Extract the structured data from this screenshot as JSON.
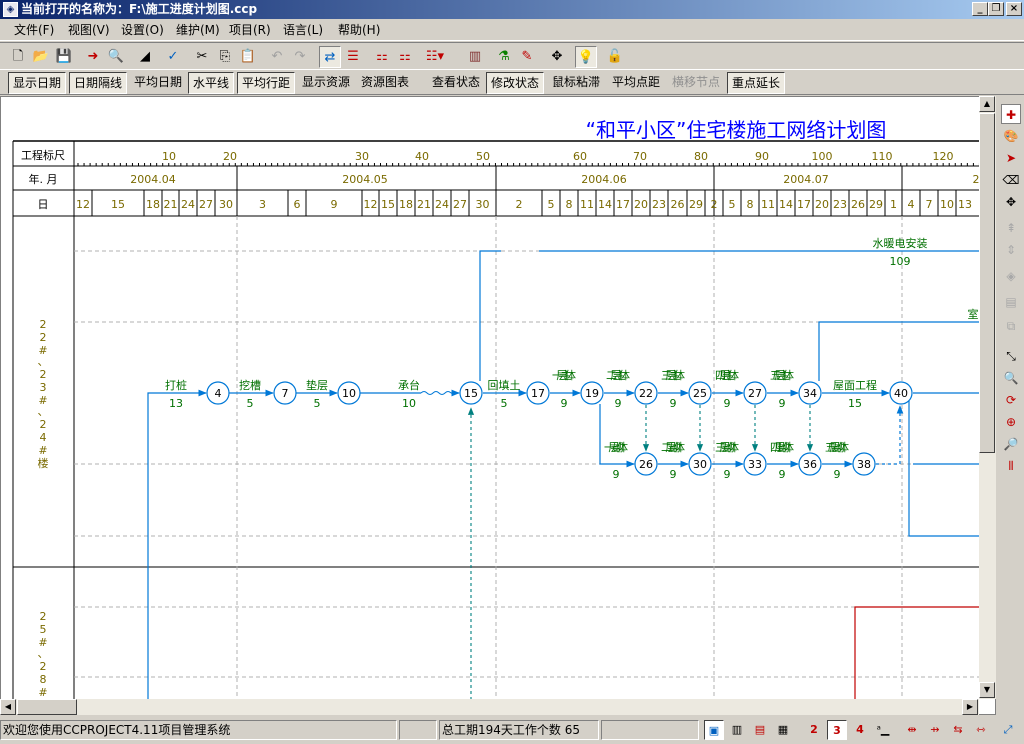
{
  "window": {
    "title": "当前打开的名称为：F:\\施工进度计划图.ccp"
  },
  "menu": [
    "文件(F)",
    "视图(V)",
    "设置(O)",
    "维护(M)",
    "项目(R)",
    "语言(L)",
    "帮助(H)"
  ],
  "toolbar2": [
    {
      "label": "显示日期",
      "state": "pressed"
    },
    {
      "label": "日期隔线",
      "state": "pressed"
    },
    {
      "label": "平均日期",
      "state": "normal"
    },
    {
      "label": "水平线",
      "state": "pressed"
    },
    {
      "label": "平均行距",
      "state": "pressed"
    },
    {
      "label": "显示资源",
      "state": "normal"
    },
    {
      "label": "资源图表",
      "state": "normal"
    },
    {
      "label": "查看状态",
      "state": "normal"
    },
    {
      "label": "修改状态",
      "state": "pressed"
    },
    {
      "label": "鼠标粘滞",
      "state": "normal"
    },
    {
      "label": "平均点距",
      "state": "normal"
    },
    {
      "label": "横移节点",
      "state": "disabled"
    },
    {
      "label": "重点延长",
      "state": "pressed"
    }
  ],
  "chart": {
    "title": "“和平小区”住宅楼施工网络计划图",
    "row_labels": {
      "scale": "工程标尺",
      "month": "年. 月",
      "day": "日"
    },
    "scale_ticks": [
      "10",
      "20",
      "30",
      "40",
      "50",
      "60",
      "70",
      "80",
      "90",
      "100",
      "110",
      "120"
    ],
    "months": [
      "2004.04",
      "2004.05",
      "2004.06",
      "2004.07",
      "2"
    ],
    "days": [
      "12",
      "15",
      "18",
      "21",
      "24",
      "27",
      "30",
      "3",
      "6",
      "9",
      "12",
      "15",
      "18",
      "21",
      "24",
      "27",
      "30",
      "2",
      "5",
      "8",
      "11",
      "14",
      "17",
      "20",
      "23",
      "26",
      "29",
      "2",
      "5",
      "8",
      "11",
      "14",
      "17",
      "20",
      "23",
      "26",
      "29",
      "1",
      "4",
      "7",
      "10",
      "13"
    ],
    "sections": [
      {
        "label": [
          "2",
          "2",
          "#",
          "、",
          "2",
          "3",
          "#",
          "、",
          "2",
          "4",
          "#",
          "楼"
        ]
      },
      {
        "label": [
          "2",
          "5",
          "#",
          "、",
          "2",
          "8",
          "#"
        ]
      }
    ],
    "nodes": [
      "4",
      "7",
      "10",
      "15",
      "17",
      "19",
      "22",
      "25",
      "27",
      "34",
      "40",
      "26",
      "30",
      "33",
      "36",
      "38"
    ],
    "tasks": [
      {
        "name": "打桩",
        "duration": "13"
      },
      {
        "name": "挖槽",
        "duration": "5"
      },
      {
        "name": "垫层",
        "duration": "5"
      },
      {
        "name": "承台",
        "duration": "10"
      },
      {
        "name": "回填土",
        "duration": "5"
      },
      {
        "name": "一层主体",
        "duration": "9"
      },
      {
        "name": "二层主体",
        "duration": "9"
      },
      {
        "name": "三层主体",
        "duration": "9"
      },
      {
        "name": "四层主体",
        "duration": "9"
      },
      {
        "name": "五层主体",
        "duration": "9"
      },
      {
        "name": "屋面工程",
        "duration": "15"
      },
      {
        "name": "一层砌体",
        "duration": "9"
      },
      {
        "name": "二层砌体",
        "duration": "9"
      },
      {
        "name": "三层砌体",
        "duration": "9"
      },
      {
        "name": "四层砌体",
        "duration": "9"
      },
      {
        "name": "五层砌体",
        "duration": "9"
      },
      {
        "name": "水暖电安装",
        "duration": "109"
      },
      {
        "name": "室",
        "duration": ""
      }
    ]
  },
  "status": {
    "message": "欢迎您使用CCPROJECT4.11项目管理系统",
    "summary": "总工期194天工作个数 65",
    "nums": [
      "2",
      "3",
      "4"
    ]
  },
  "colors": {
    "line": "#0078d7",
    "text_green": "#007000",
    "text_gold": "#7a6a00",
    "title_blue": "#0000ff",
    "critical_red": "#c00000"
  }
}
